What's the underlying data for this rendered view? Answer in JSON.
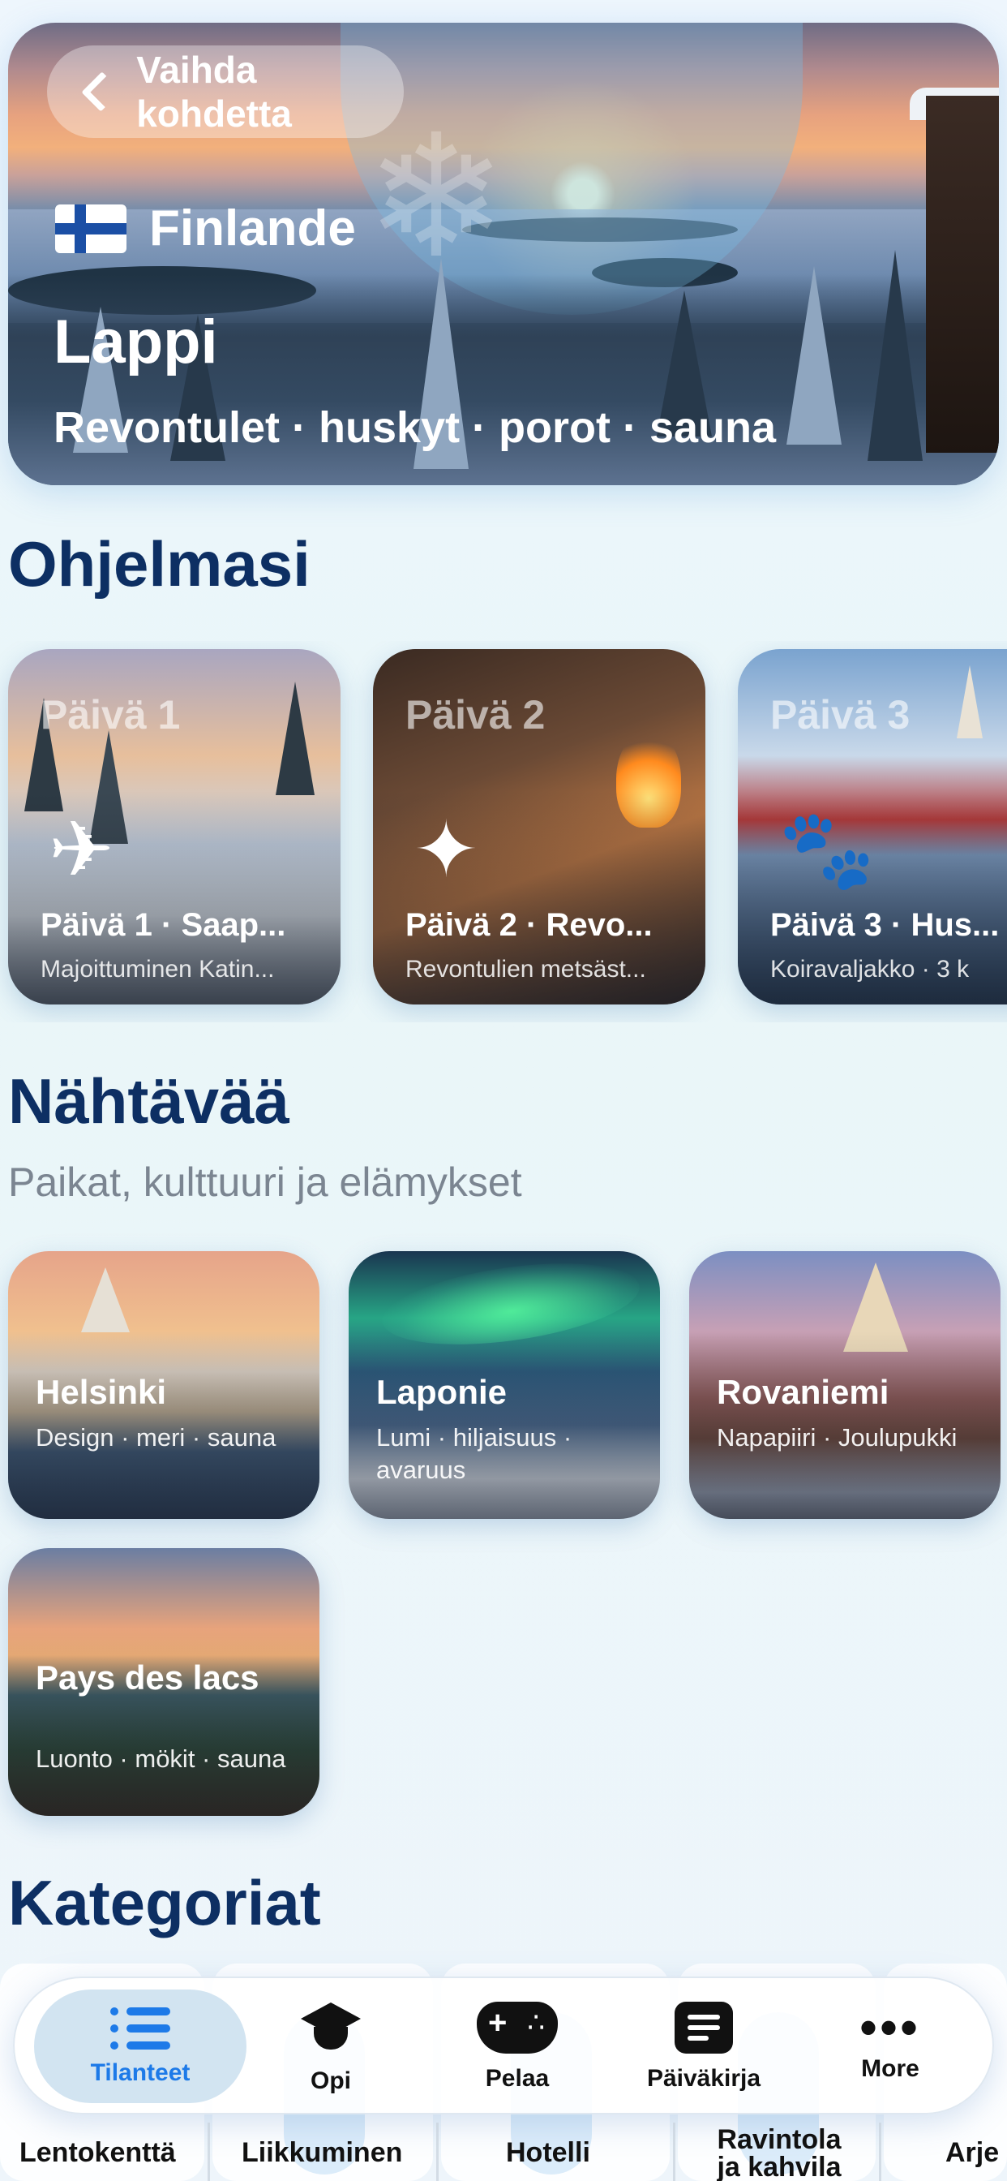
{
  "hero": {
    "back_label": "Vaihda kohdetta",
    "country": "Finlande",
    "flag_icon": "finland-flag",
    "title": "Lappi",
    "subtitle": "Revontulet · huskyt · porot · sauna"
  },
  "program": {
    "title": "Ohjelmasi",
    "days": [
      {
        "header": "Päivä 1",
        "icon": "airplane-landing-icon",
        "name": "Päivä 1 · Saap...",
        "desc": "Majoittuminen Katin..."
      },
      {
        "header": "Päivä 2",
        "icon": "sparkles-icon",
        "name": "Päivä 2 · Revo...",
        "desc": "Revontulien metsäst..."
      },
      {
        "header": "Päivä 3",
        "icon": "paw-icon",
        "name": "Päivä 3 · Hus...",
        "desc": "Koiravaljakko · 3 k"
      }
    ]
  },
  "sights": {
    "title": "Nähtävää",
    "subtitle": "Paikat, kulttuuri ja elämykset",
    "items": [
      {
        "name": "Helsinki",
        "desc": "Design · meri · sauna"
      },
      {
        "name": "Laponie",
        "desc": "Lumi · hiljaisuus · avaruus"
      },
      {
        "name": "Rovaniemi",
        "desc": "Napapiiri · Joulupukki"
      },
      {
        "name": "Pays des lacs",
        "desc": "Luonto · mökit · sauna"
      }
    ]
  },
  "categories": {
    "title": "Kategoriat",
    "items": [
      "Lentokenttä",
      "Liikkuminen",
      "Hotelli",
      "Ravintola ja kahvila",
      "Arje"
    ]
  },
  "tabbar": {
    "active_color": "#1d7ae8",
    "tabs": [
      {
        "label": "Tilanteet",
        "icon": "list-icon",
        "active": true
      },
      {
        "label": "Opi",
        "icon": "graduation-cap-icon",
        "active": false
      },
      {
        "label": "Pelaa",
        "icon": "gamepad-icon",
        "active": false
      },
      {
        "label": "Päiväkirja",
        "icon": "journal-icon",
        "active": false
      },
      {
        "label": "More",
        "icon": "more-dots-icon",
        "active": false
      }
    ]
  }
}
